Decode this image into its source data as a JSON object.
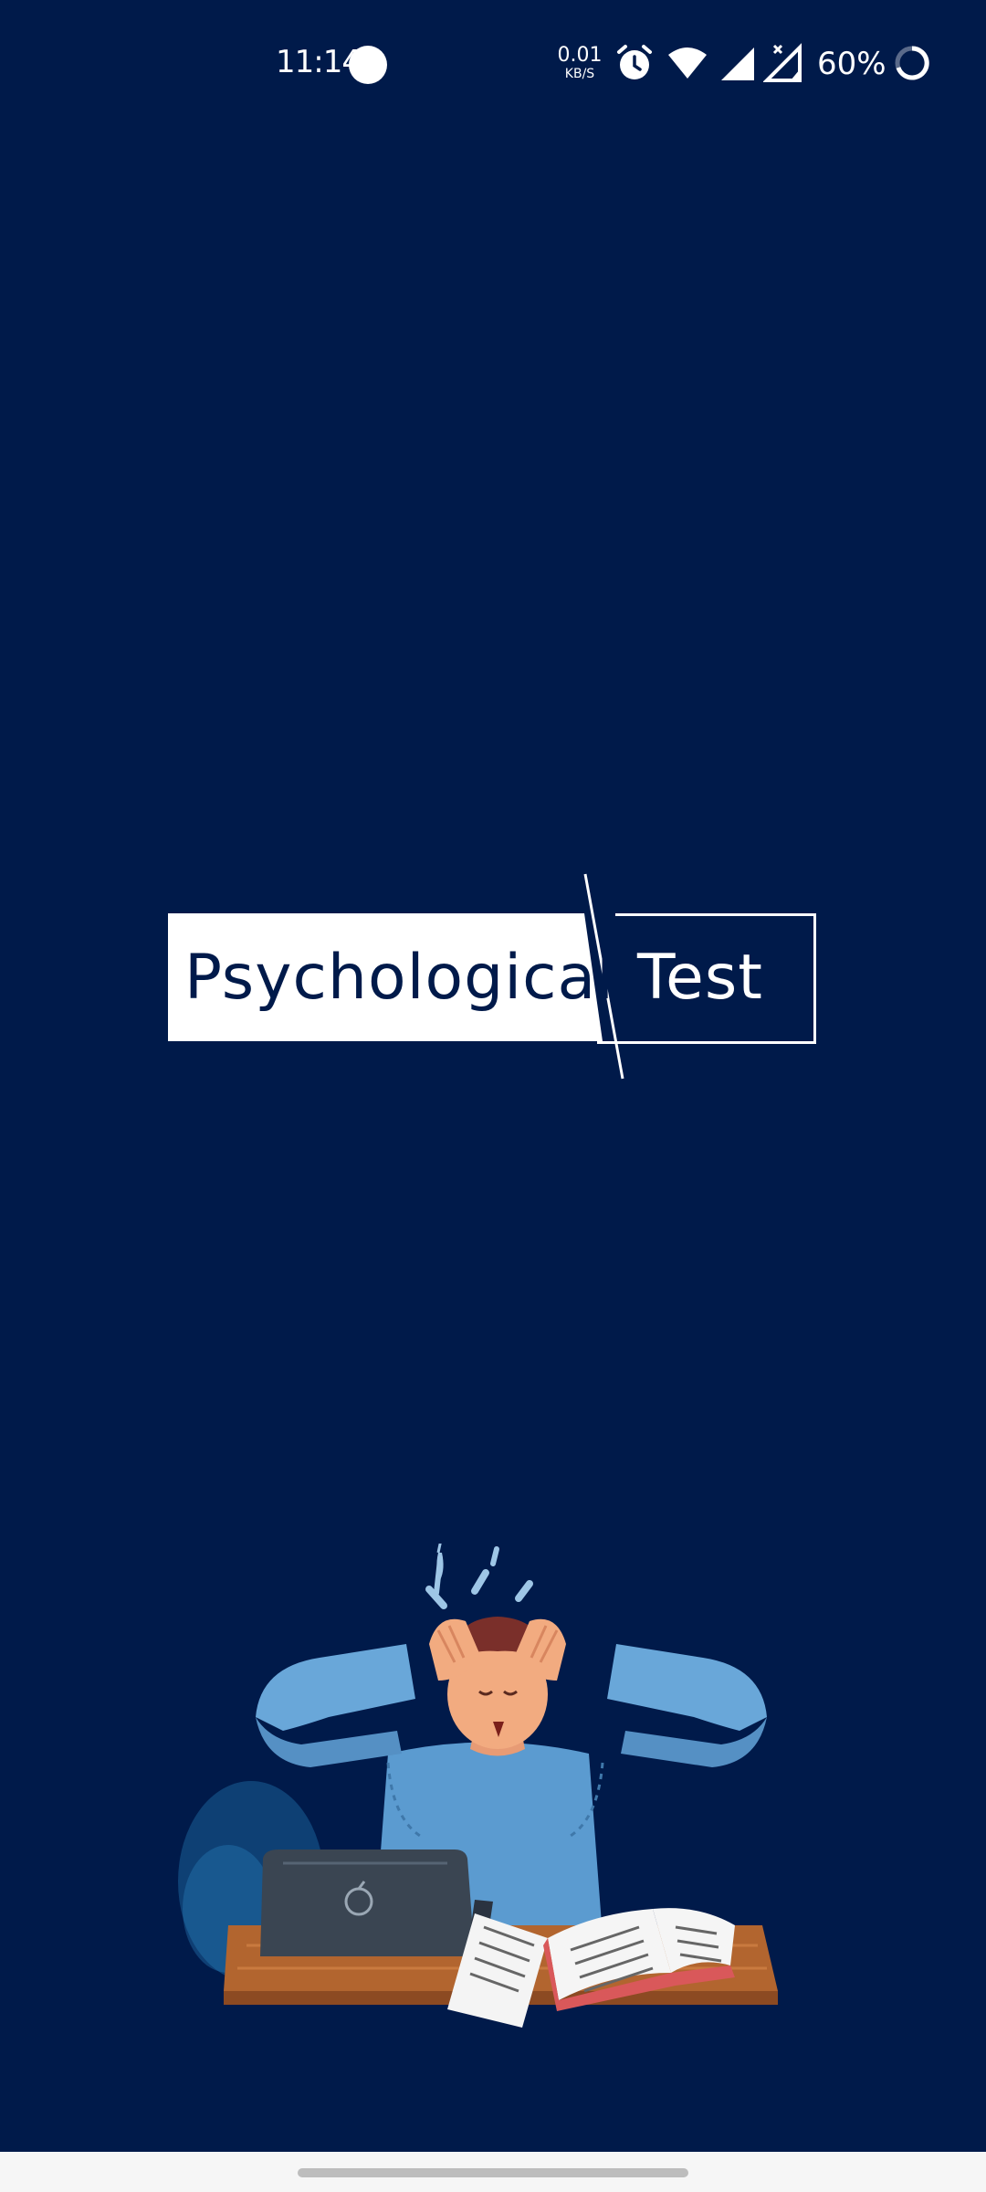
{
  "status_bar": {
    "time": "11:14",
    "net_speed_value": "0.01",
    "net_speed_unit": "KB/S",
    "battery_percent": "60%",
    "icons": [
      "circle-notification-icon",
      "alarm-icon",
      "wifi-icon",
      "signal-icon",
      "signal-no-data-icon",
      "battery-ring-icon"
    ]
  },
  "logo": {
    "word_1": "Psychological",
    "word_2": "Test"
  },
  "illustration": {
    "subject": "stressed-student-at-desk"
  },
  "colors": {
    "background": "#001a4a",
    "logo_box": "#ffffff",
    "nav_bar": "#f6f6f6"
  }
}
